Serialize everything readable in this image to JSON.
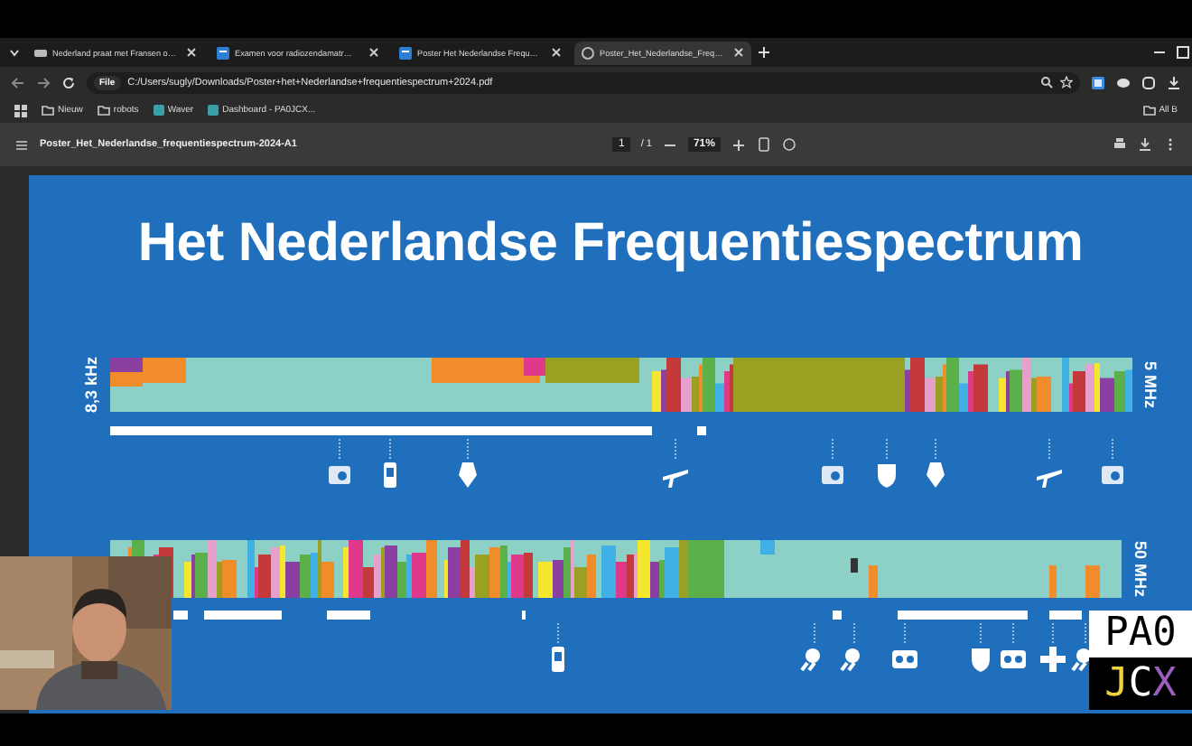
{
  "browser": {
    "tabs": [
      {
        "label": "Nederland praat met Fransen o…",
        "kind": "video",
        "selected": false
      },
      {
        "label": "Examen voor radiozendamatr…",
        "kind": "doc",
        "selected": false
      },
      {
        "label": "Poster Het Nederlandse Frequ…",
        "kind": "doc",
        "selected": false
      },
      {
        "label": "Poster_Het_Nederlandse_Freq…",
        "kind": "globe",
        "selected": true
      }
    ],
    "address": {
      "chip": "File",
      "url": "C:/Users/sugly/Downloads/Poster+het+Nederlandse+frequentiespectrum+2024.pdf"
    },
    "bookmarks": [
      {
        "label": "Nieuw",
        "kind": "folder"
      },
      {
        "label": "robots",
        "kind": "folder"
      },
      {
        "label": "Waver",
        "kind": "site"
      },
      {
        "label": "Dashboard - PA0JCX...",
        "kind": "site"
      }
    ],
    "all_bookmarks": "All B"
  },
  "pdf_toolbar": {
    "title": "Poster_Het_Nederlandse_frequentiespectrum-2024-A1",
    "page": "1",
    "pages": "/ 1",
    "zoom": "71%"
  },
  "poster": {
    "title": "Het Nederlandse Frequentiespectrum",
    "bands": [
      {
        "start": "8,3 kHz",
        "end": "5 MHz"
      },
      {
        "end": "50 MHz"
      }
    ]
  },
  "callsign": {
    "top": "PA0",
    "letters": [
      {
        "text": "J",
        "color": "#f0d23c"
      },
      {
        "text": "C",
        "color": "#ffffff"
      },
      {
        "text": "X",
        "color": "#9b5fc0"
      }
    ]
  }
}
